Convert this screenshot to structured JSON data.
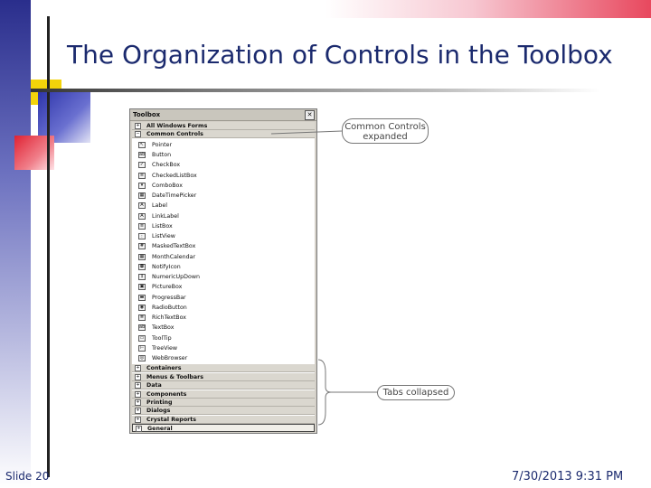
{
  "slide": {
    "title": "The Organization of Controls in the Toolbox",
    "footer_left": "Slide 20",
    "footer_right": "7/30/2013  9:31 PM"
  },
  "toolbox": {
    "title": "Toolbox",
    "close_glyph": "✕",
    "headers_top": [
      {
        "label": "All Windows Forms",
        "sign": "+"
      },
      {
        "label": "Common Controls",
        "sign": "−"
      }
    ],
    "items": [
      {
        "label": "Pointer",
        "icon": "pointer-icon"
      },
      {
        "label": "Button",
        "icon": "button-icon"
      },
      {
        "label": "CheckBox",
        "icon": "checkbox-icon"
      },
      {
        "label": "CheckedListBox",
        "icon": "checkedlistbox-icon"
      },
      {
        "label": "ComboBox",
        "icon": "combobox-icon"
      },
      {
        "label": "DateTimePicker",
        "icon": "datetimepicker-icon"
      },
      {
        "label": "Label",
        "icon": "label-icon"
      },
      {
        "label": "LinkLabel",
        "icon": "linklabel-icon"
      },
      {
        "label": "ListBox",
        "icon": "listbox-icon"
      },
      {
        "label": "ListView",
        "icon": "listview-icon"
      },
      {
        "label": "MaskedTextBox",
        "icon": "maskedtextbox-icon"
      },
      {
        "label": "MonthCalendar",
        "icon": "monthcalendar-icon"
      },
      {
        "label": "NotifyIcon",
        "icon": "notifyicon-icon"
      },
      {
        "label": "NumericUpDown",
        "icon": "numericupdown-icon"
      },
      {
        "label": "PictureBox",
        "icon": "picturebox-icon"
      },
      {
        "label": "ProgressBar",
        "icon": "progressbar-icon"
      },
      {
        "label": "RadioButton",
        "icon": "radiobutton-icon"
      },
      {
        "label": "RichTextBox",
        "icon": "richtextbox-icon"
      },
      {
        "label": "TextBox",
        "icon": "textbox-icon"
      },
      {
        "label": "ToolTip",
        "icon": "tooltip-icon"
      },
      {
        "label": "TreeView",
        "icon": "treeview-icon"
      },
      {
        "label": "WebBrowser",
        "icon": "webbrowser-icon"
      }
    ],
    "headers_bottom": [
      {
        "label": "Containers",
        "sign": "+"
      },
      {
        "label": "Menus & Toolbars",
        "sign": "+"
      },
      {
        "label": "Data",
        "sign": "+"
      },
      {
        "label": "Components",
        "sign": "+"
      },
      {
        "label": "Printing",
        "sign": "+"
      },
      {
        "label": "Dialogs",
        "sign": "+"
      },
      {
        "label": "Crystal Reports",
        "sign": "+"
      },
      {
        "label": "General",
        "sign": "+"
      }
    ]
  },
  "callouts": {
    "expanded": "Common Controls expanded",
    "collapsed": "Tabs collapsed"
  },
  "colors": {
    "title": "#1b2a6e",
    "accent_red": "#e02233",
    "accent_yellow": "#f3d30a",
    "accent_blue": "#2a31a8"
  }
}
